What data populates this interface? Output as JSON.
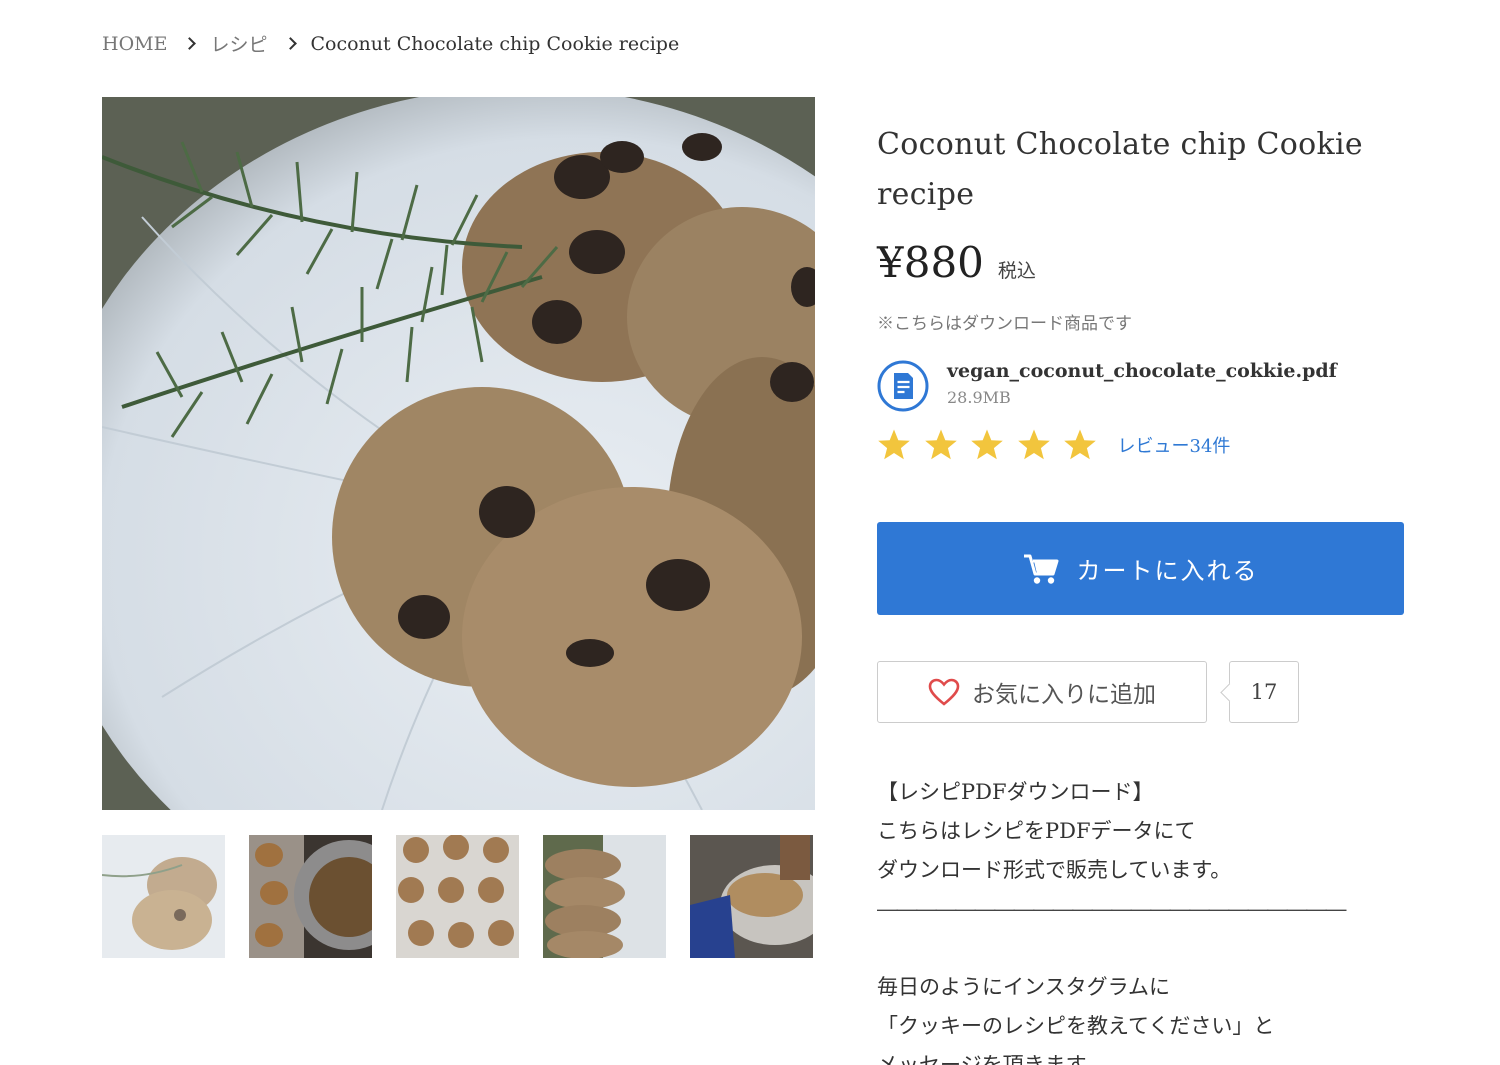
{
  "breadcrumb": {
    "home": "HOME",
    "category": "レシピ",
    "current": "Coconut Chocolate chip Cookie recipe"
  },
  "product": {
    "title": "Coconut Chocolate chip Cookie recipe",
    "price": "¥880",
    "tax_label": "税込",
    "download_note": "※こちらはダウンロード商品です",
    "file_name": "vegan_coconut_chocolate_cokkie.pdf",
    "file_size": "28.9MB",
    "rating_stars": 5,
    "reviews_link": "レビュー34件",
    "cart_button": "カートに入れる",
    "favorite_button": "お気に入りに追加",
    "favorite_count": "17"
  },
  "description": [
    "【レシピPDFダウンロード】",
    "こちらはレシピをPDFデータにて",
    "ダウンロード形式で販売しています。",
    "――――――――――――――――――――――――",
    "",
    "毎日のようにインスタグラムに",
    "「クッキーのレシピを教えてください」と",
    "メッセージを頂きます。"
  ],
  "icons": {
    "breadcrumb_separator": "chevron-right-icon",
    "file": "document-icon",
    "star": "star-icon",
    "cart": "cart-icon",
    "favorite": "heart-icon"
  },
  "colors": {
    "accent_blue": "#2f78d5",
    "star_yellow": "#f2c53d",
    "heart_red": "#e04b4b"
  }
}
